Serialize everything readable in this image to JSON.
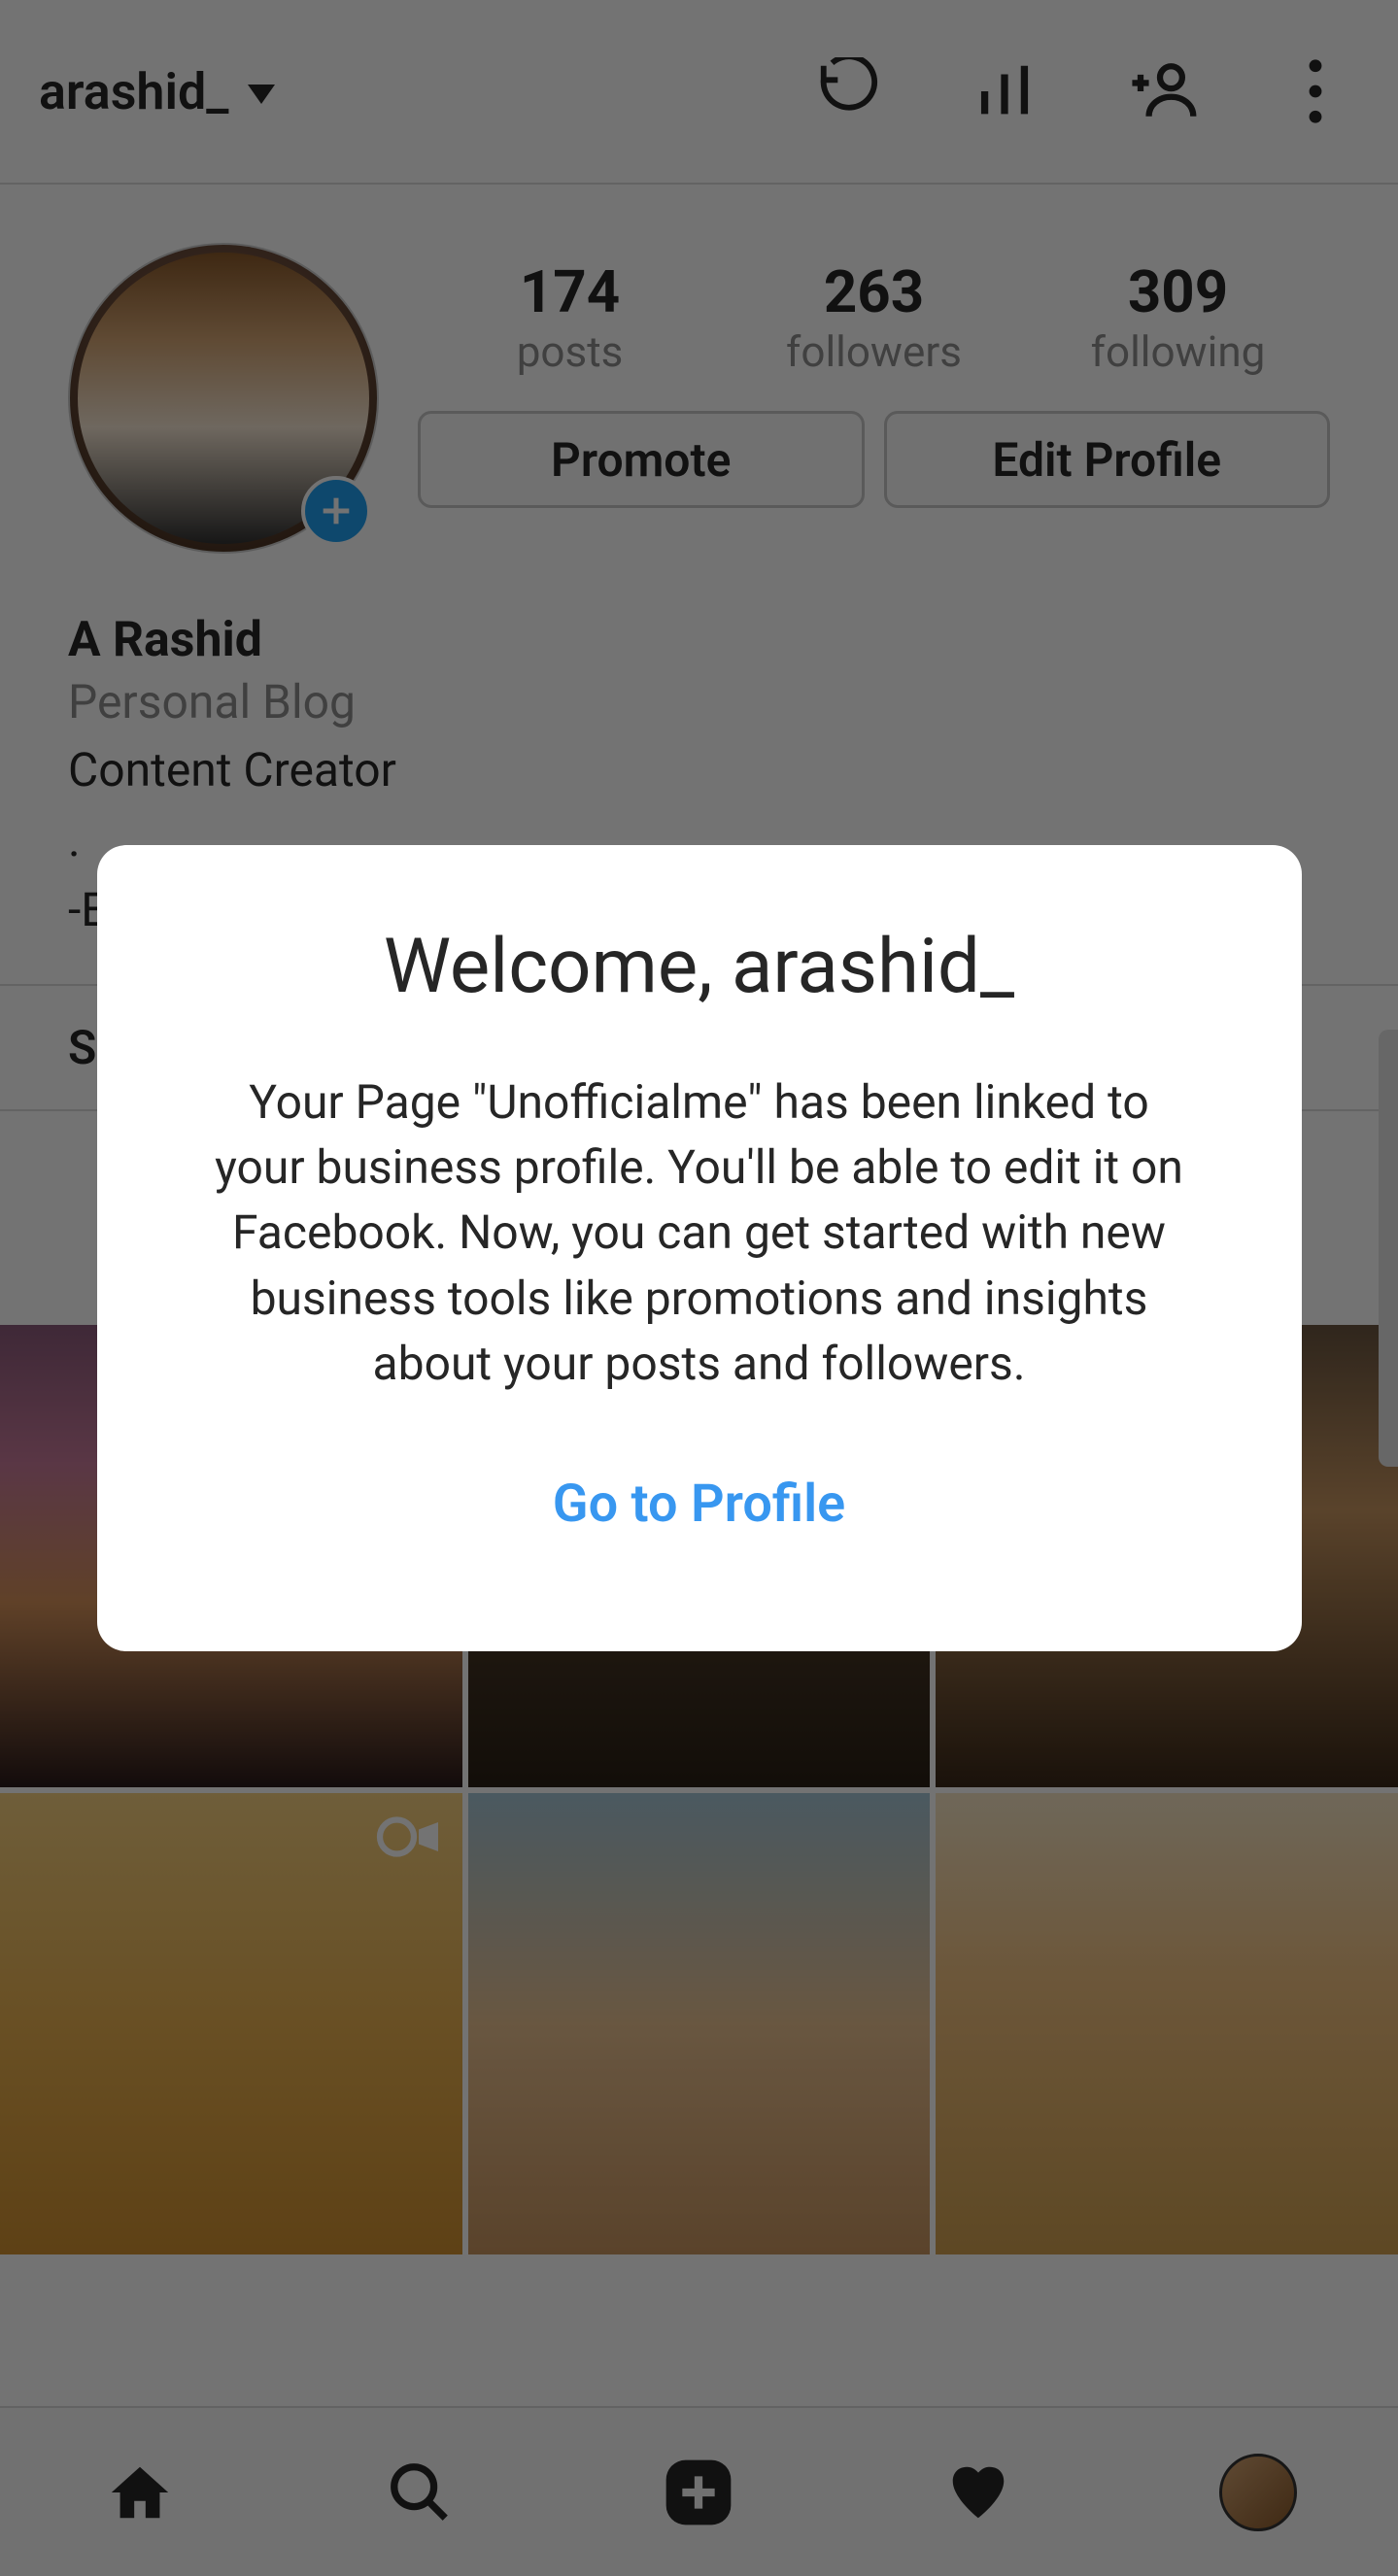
{
  "header": {
    "username": "arashid_"
  },
  "profile": {
    "stats": {
      "posts": {
        "count": "174",
        "label": "posts"
      },
      "followers": {
        "count": "263",
        "label": "followers"
      },
      "following": {
        "count": "309",
        "label": "following"
      }
    },
    "buttons": {
      "promote": "Promote",
      "edit_profile": "Edit Profile"
    },
    "bio": {
      "name": "A Rashid",
      "category": "Personal Blog",
      "line1": "Content Creator",
      "line2": ".",
      "line3": "-E"
    }
  },
  "section_label": "S",
  "modal": {
    "title": "Welcome, arashid_",
    "body": "Your Page \"Unofficialme\" has been linked to your business profile. You'll be able to edit it on Facebook. Now, you can get started with new business tools like promotions and insights about your posts and followers.",
    "link": "Go to Profile"
  },
  "icons": {
    "archive": "archive-icon",
    "insights": "insights-icon",
    "discover_people": "discover-people-icon",
    "more": "more-icon"
  }
}
